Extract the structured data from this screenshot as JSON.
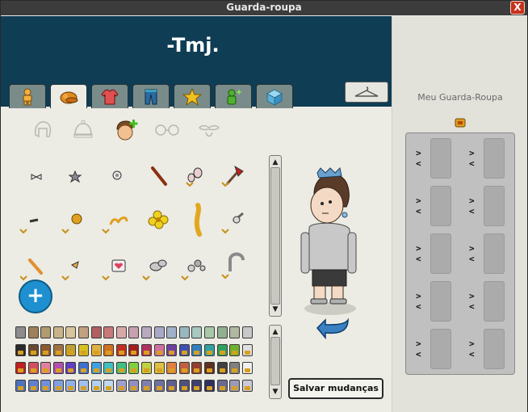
{
  "window": {
    "title": "Guarda-roupa",
    "close_label": "X"
  },
  "header": {
    "name": "-Tmj."
  },
  "tabs": [
    {
      "name": "body",
      "icon": "person-icon"
    },
    {
      "name": "hats",
      "icon": "cap-icon"
    },
    {
      "name": "shirts",
      "icon": "shirt-icon"
    },
    {
      "name": "pants",
      "icon": "pants-icon"
    },
    {
      "name": "star",
      "icon": "star-icon"
    },
    {
      "name": "effects",
      "icon": "sparkle-person-icon"
    },
    {
      "name": "hc",
      "icon": "cube-icon"
    }
  ],
  "subcategories": [
    {
      "icon": "hair-icon"
    },
    {
      "icon": "beanie-icon"
    },
    {
      "icon": "head-plus-icon"
    },
    {
      "icon": "glasses-icon"
    },
    {
      "icon": "moustache-icon"
    }
  ],
  "actions": {
    "add_label": "+",
    "save_label": "Salvar mudanças"
  },
  "wardrobe": {
    "title": "Meu Guarda-Roupa",
    "slot_left_arrow": "<",
    "slot_right_arrow": ">"
  },
  "colors": {
    "header": "#0f3d54",
    "add_button": "#1e90d0",
    "palette_row1": [
      "#8c8c8c",
      "#a0805a",
      "#b09a70",
      "#c8b488",
      "#d8c49a",
      "#c0a080",
      "#b06060",
      "#c87878",
      "#d8a8a8",
      "#c8a0b0",
      "#b8a8c0",
      "#a8a8c8",
      "#a0b0c8",
      "#98b8c0",
      "#a8c8c0",
      "#a8c8a8",
      "#90b090",
      "#b0b8a0",
      "#c8c8c8"
    ],
    "palette_row2": [
      "#2a2a2a",
      "#6a4a30",
      "#8a5a30",
      "#a07040",
      "#c0a030",
      "#d8c020",
      "#e0b040",
      "#d07020",
      "#c03020",
      "#a02020",
      "#b03060",
      "#d070a0",
      "#7040a0",
      "#4050b0",
      "#3080c0",
      "#30a0a0",
      "#30a060",
      "#70b030",
      "#e0e0e0"
    ],
    "palette_row3": [
      "#c02020",
      "#d05060",
      "#e080a0",
      "#b050b0",
      "#6040c0",
      "#4070d0",
      "#40a0e0",
      "#40c0c0",
      "#40c080",
      "#80d040",
      "#c0d040",
      "#e0c040",
      "#e08040",
      "#c06040",
      "#904030",
      "#603020",
      "#404040",
      "#808080",
      "#f0f0f0"
    ],
    "palette_row4": [
      "#5070c0",
      "#6080d0",
      "#7090d8",
      "#80a0e0",
      "#90b0e8",
      "#a0c0f0",
      "#b0d0f0",
      "#c0d8f0",
      "#a0a0d0",
      "#9090c0",
      "#8080b0",
      "#7070a0",
      "#606090",
      "#505080",
      "#404070",
      "#303060",
      "#6a6a90",
      "#9a9ab8",
      "#cacad8"
    ]
  }
}
